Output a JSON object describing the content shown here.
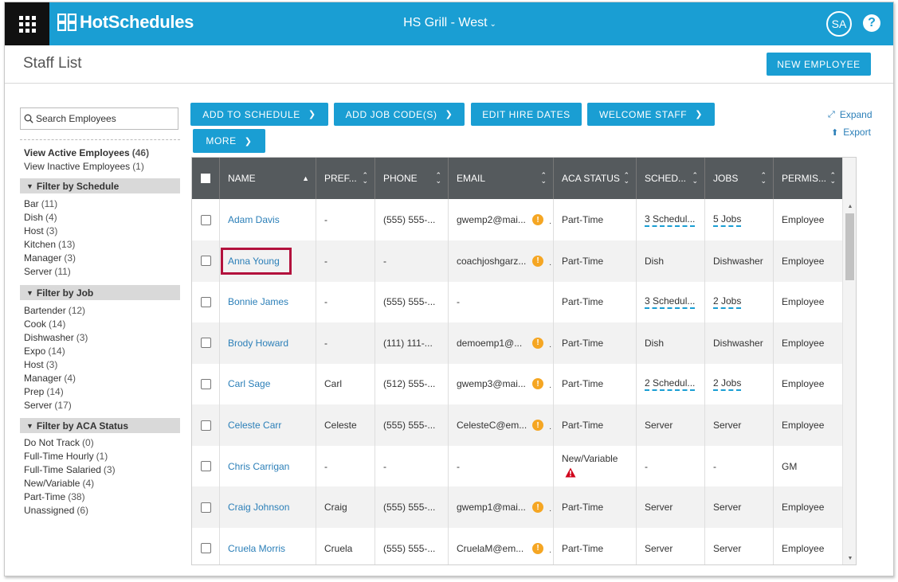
{
  "app": {
    "brand": "HotSchedules",
    "location": "HS Grill - West",
    "avatar_initials": "SA",
    "help_label": "?"
  },
  "header": {
    "title": "Staff List",
    "new_employee": "NEW EMPLOYEE"
  },
  "toolbar": {
    "add_to_schedule": "ADD TO SCHEDULE",
    "add_job_codes": "ADD JOB CODE(S)",
    "edit_hire_dates": "EDIT HIRE DATES",
    "welcome_staff": "WELCOME STAFF",
    "more": "MORE",
    "expand": "Expand",
    "export": "Export"
  },
  "sidebar": {
    "search_placeholder": "Search Employees",
    "views": [
      {
        "label": "View Active Employees",
        "count": "(46)"
      },
      {
        "label": "View Inactive Employees",
        "count": "(1)"
      }
    ],
    "filter_schedule": {
      "title": "Filter by Schedule",
      "items": [
        {
          "label": "Bar",
          "count": "(11)"
        },
        {
          "label": "Dish",
          "count": "(4)"
        },
        {
          "label": "Host",
          "count": "(3)"
        },
        {
          "label": "Kitchen",
          "count": "(13)"
        },
        {
          "label": "Manager",
          "count": "(3)"
        },
        {
          "label": "Server",
          "count": "(11)"
        }
      ]
    },
    "filter_job": {
      "title": "Filter by Job",
      "items": [
        {
          "label": "Bartender",
          "count": "(12)"
        },
        {
          "label": "Cook",
          "count": "(14)"
        },
        {
          "label": "Dishwasher",
          "count": "(3)"
        },
        {
          "label": "Expo",
          "count": "(14)"
        },
        {
          "label": "Host",
          "count": "(3)"
        },
        {
          "label": "Manager",
          "count": "(4)"
        },
        {
          "label": "Prep",
          "count": "(14)"
        },
        {
          "label": "Server",
          "count": "(17)"
        }
      ]
    },
    "filter_aca": {
      "title": "Filter by ACA Status",
      "items": [
        {
          "label": "Do Not Track",
          "count": "(0)"
        },
        {
          "label": "Full-Time Hourly",
          "count": "(1)"
        },
        {
          "label": "Full-Time Salaried",
          "count": "(3)"
        },
        {
          "label": "New/Variable",
          "count": "(4)"
        },
        {
          "label": "Part-Time",
          "count": "(38)"
        },
        {
          "label": "Unassigned",
          "count": "(6)"
        }
      ]
    }
  },
  "table": {
    "columns": [
      "NAME",
      "PREF...",
      "PHONE",
      "EMAIL",
      "ACA STATUS",
      "SCHED...",
      "JOBS",
      "PERMIS..."
    ],
    "rows": [
      {
        "name": "Adam Davis",
        "pref": "-",
        "phone": "(555) 555-...",
        "email": "gwemp2@mai...",
        "email_warn": true,
        "aca": "Part-Time",
        "sched": "3 Schedul...",
        "sched_link": true,
        "jobs": "5 Jobs",
        "jobs_link": true,
        "perm": "Employee"
      },
      {
        "name": "Anna Young",
        "pref": "-",
        "phone": "-",
        "email": "coachjoshgarz...",
        "email_warn": true,
        "aca": "Part-Time",
        "sched": "Dish",
        "sched_link": false,
        "jobs": "Dishwasher",
        "jobs_link": false,
        "perm": "Employee"
      },
      {
        "name": "Bonnie James",
        "pref": "-",
        "phone": "(555) 555-...",
        "email": "-",
        "email_warn": false,
        "aca": "Part-Time",
        "sched": "3 Schedul...",
        "sched_link": true,
        "jobs": "2 Jobs",
        "jobs_link": true,
        "perm": "Employee"
      },
      {
        "name": "Brody Howard",
        "pref": "-",
        "phone": "(111) 111-...",
        "email": "demoemp1@...",
        "email_warn": true,
        "aca": "Part-Time",
        "sched": "Dish",
        "sched_link": false,
        "jobs": "Dishwasher",
        "jobs_link": false,
        "perm": "Employee"
      },
      {
        "name": "Carl Sage",
        "pref": "Carl",
        "phone": "(512) 555-...",
        "email": "gwemp3@mai...",
        "email_warn": true,
        "aca": "Part-Time",
        "sched": "2 Schedul...",
        "sched_link": true,
        "jobs": "2 Jobs",
        "jobs_link": true,
        "perm": "Employee"
      },
      {
        "name": "Celeste Carr",
        "pref": "Celeste",
        "phone": "(555) 555-...",
        "email": "CelesteC@em...",
        "email_warn": true,
        "aca": "Part-Time",
        "sched": "Server",
        "sched_link": false,
        "jobs": "Server",
        "jobs_link": false,
        "perm": "Employee"
      },
      {
        "name": "Chris Carrigan",
        "pref": "-",
        "phone": "-",
        "email": "-",
        "email_warn": false,
        "aca": "New/Variable",
        "aca_warn": true,
        "sched": "-",
        "sched_link": false,
        "jobs": "-",
        "jobs_link": false,
        "perm": "GM"
      },
      {
        "name": "Craig Johnson",
        "pref": "Craig",
        "phone": "(555) 555-...",
        "email": "gwemp1@mai...",
        "email_warn": true,
        "aca": "Part-Time",
        "sched": "Server",
        "sched_link": false,
        "jobs": "Server",
        "jobs_link": false,
        "perm": "Employee"
      },
      {
        "name": "Cruela Morris",
        "pref": "Cruela",
        "phone": "(555) 555-...",
        "email": "CruelaM@em...",
        "email_warn": true,
        "aca": "Part-Time",
        "sched": "Server",
        "sched_link": false,
        "jobs": "Server",
        "jobs_link": false,
        "perm": "Employee"
      }
    ]
  },
  "colors": {
    "brand_blue": "#1a9ed3",
    "header_gray": "#555a5d",
    "link_blue": "#2b7fb8",
    "highlight_red": "#b3123d",
    "warn_orange": "#f5a623",
    "alert_red": "#d0021b"
  }
}
